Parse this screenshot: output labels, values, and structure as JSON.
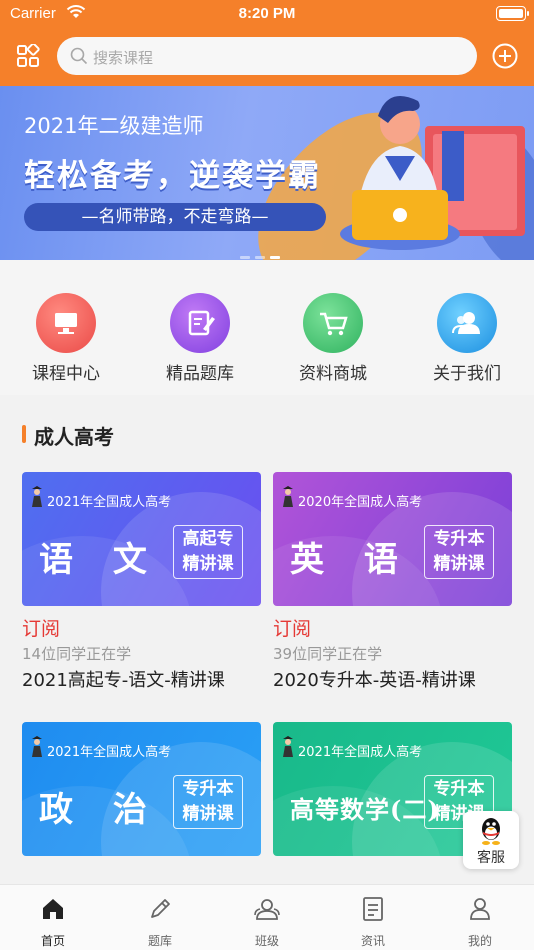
{
  "status_bar": {
    "carrier": "Carrier",
    "time": "8:20 PM"
  },
  "header": {
    "search_placeholder": "搜索课程"
  },
  "banner": {
    "title": "2021年二级建造师",
    "headline": "轻松备考，逆袭学霸",
    "tagline": "—名师带路，不走弯路—",
    "active_slide": 3,
    "slide_count": 3
  },
  "quick_menu": [
    {
      "label": "课程中心",
      "icon": "monitor-icon",
      "color": "#f0625a"
    },
    {
      "label": "精品题库",
      "icon": "edit-icon",
      "color": "#9b4ee0"
    },
    {
      "label": "资料商城",
      "icon": "cart-icon",
      "color": "#3fbf6a"
    },
    {
      "label": "关于我们",
      "icon": "users-icon",
      "color": "#2aa3e6"
    }
  ],
  "section": {
    "title": "成人高考"
  },
  "courses": [
    {
      "banner_sub": "2021年全国成人高考",
      "subject": "语 文",
      "tag_line1": "高起专",
      "tag_line2": "精讲课",
      "subscribe": "订阅",
      "learners": "14位同学正在学",
      "title": "2021高起专-语文-精讲课",
      "gradient_from": "#4f6ff0",
      "gradient_to": "#6a4ef0"
    },
    {
      "banner_sub": "2020年全国成人高考",
      "subject": "英 语",
      "tag_line1": "专升本",
      "tag_line2": "精讲课",
      "subscribe": "订阅",
      "learners": "39位同学正在学",
      "title": "2020专升本-英语-精讲课",
      "gradient_from": "#b154d8",
      "gradient_to": "#7a3fd8"
    },
    {
      "banner_sub": "2021年全国成人高考",
      "subject": "政 治",
      "tag_line1": "专升本",
      "tag_line2": "精讲课",
      "gradient_from": "#1f8cf0",
      "gradient_to": "#2aa0f5"
    },
    {
      "banner_sub": "2021年全国成人高考",
      "subject": "高等数学(二)",
      "tag_line1": "专升本",
      "tag_line2": "精讲课",
      "gradient_from": "#19b98a",
      "gradient_to": "#1fc896"
    }
  ],
  "customer_service": {
    "label": "客服"
  },
  "tabs": [
    {
      "label": "首页",
      "icon": "home-icon",
      "active": true
    },
    {
      "label": "题库",
      "icon": "pencil-icon",
      "active": false
    },
    {
      "label": "班级",
      "icon": "class-icon",
      "active": false
    },
    {
      "label": "资讯",
      "icon": "news-icon",
      "active": false
    },
    {
      "label": "我的",
      "icon": "profile-icon",
      "active": false
    }
  ]
}
